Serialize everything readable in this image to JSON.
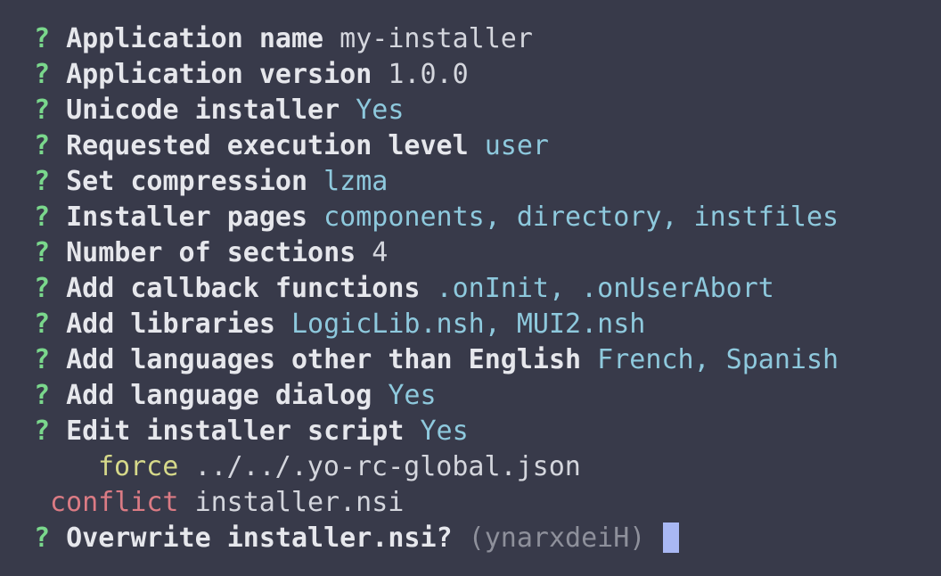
{
  "prompts": [
    {
      "mark": "?",
      "label": "Application name",
      "value": "my-installer",
      "style": "plain"
    },
    {
      "mark": "?",
      "label": "Application version",
      "value": "1.0.0",
      "style": "plain"
    },
    {
      "mark": "?",
      "label": "Unicode installer",
      "value": "Yes",
      "style": "cyan"
    },
    {
      "mark": "?",
      "label": "Requested execution level",
      "value": "user",
      "style": "cyan"
    },
    {
      "mark": "?",
      "label": "Set compression",
      "value": "lzma",
      "style": "cyan"
    },
    {
      "mark": "?",
      "label": "Installer pages",
      "value": "components, directory, instfiles",
      "style": "cyan"
    },
    {
      "mark": "?",
      "label": "Number of sections",
      "value": "4",
      "style": "plain"
    },
    {
      "mark": "?",
      "label": "Add callback functions",
      "value": ".onInit, .onUserAbort",
      "style": "cyan"
    },
    {
      "mark": "?",
      "label": "Add libraries",
      "value": "LogicLib.nsh, MUI2.nsh",
      "style": "cyan"
    },
    {
      "mark": "?",
      "label": "Add languages other than English",
      "value": "French, Spanish",
      "style": "cyan"
    },
    {
      "mark": "?",
      "label": "Add language dialog",
      "value": "Yes",
      "style": "cyan"
    },
    {
      "mark": "?",
      "label": "Edit installer script",
      "value": "Yes",
      "style": "cyan"
    }
  ],
  "force_line": {
    "status": "force",
    "file": "../../.yo-rc-global.json"
  },
  "conflict_line": {
    "status": "conflict",
    "file": "installer.nsi"
  },
  "overwrite_prompt": {
    "mark": "?",
    "label": "Overwrite installer.nsi?",
    "hint": "(ynarxdeiH)"
  },
  "colors": {
    "background": "#383a4a",
    "question_mark": "#7ad78c",
    "answer_cyan": "#8ec9dd",
    "force": "#d6d98a",
    "conflict": "#db7b84",
    "cursor": "#a9b8f4"
  }
}
